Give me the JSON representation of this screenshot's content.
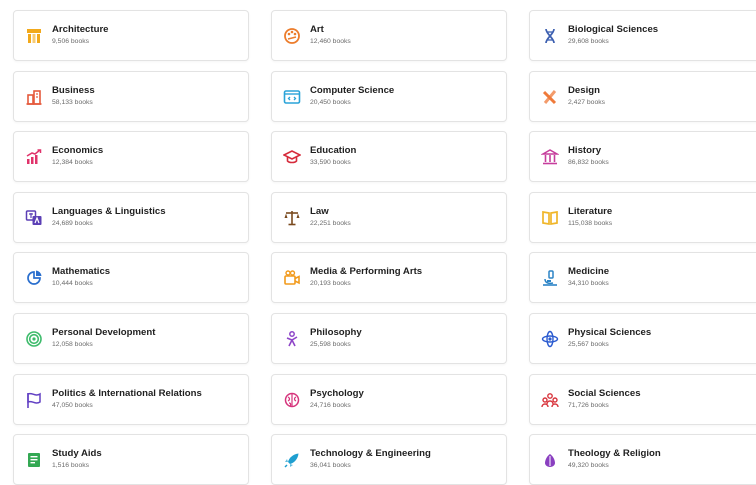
{
  "categories": [
    {
      "title": "Architecture",
      "count": "9,506 books",
      "icon": "architecture-icon",
      "color": "#f2a91b"
    },
    {
      "title": "Art",
      "count": "12,460 books",
      "icon": "palette-icon",
      "color": "#ec7c2b"
    },
    {
      "title": "Biological Sciences",
      "count": "29,608 books",
      "icon": "dna-icon",
      "color": "#3c5fb0"
    },
    {
      "title": "Business",
      "count": "58,133 books",
      "icon": "buildings-icon",
      "color": "#e55a3c"
    },
    {
      "title": "Computer Science",
      "count": "20,450 books",
      "icon": "code-window-icon",
      "color": "#2aa3d8"
    },
    {
      "title": "Design",
      "count": "2,427 books",
      "icon": "design-tools-icon",
      "color": "#ef7a3a"
    },
    {
      "title": "Economics",
      "count": "12,384 books",
      "icon": "growth-chart-icon",
      "color": "#e0336b"
    },
    {
      "title": "Education",
      "count": "33,590 books",
      "icon": "graduation-cap-icon",
      "color": "#d62b3b"
    },
    {
      "title": "History",
      "count": "86,832 books",
      "icon": "museum-icon",
      "color": "#c63d9c"
    },
    {
      "title": "Languages & Linguistics",
      "count": "24,689 books",
      "icon": "translate-icon",
      "color": "#5b3fb5"
    },
    {
      "title": "Law",
      "count": "22,251 books",
      "icon": "scales-icon",
      "color": "#7a4a1e"
    },
    {
      "title": "Literature",
      "count": "115,038 books",
      "icon": "open-book-icon",
      "color": "#f0b62a"
    },
    {
      "title": "Mathematics",
      "count": "10,444 books",
      "icon": "pie-chart-icon",
      "color": "#2b6fce"
    },
    {
      "title": "Media & Performing Arts",
      "count": "20,193 books",
      "icon": "film-camera-icon",
      "color": "#f29a1c"
    },
    {
      "title": "Medicine",
      "count": "34,310 books",
      "icon": "microscope-icon",
      "color": "#2b84c6"
    },
    {
      "title": "Personal Development",
      "count": "12,058 books",
      "icon": "target-icon",
      "color": "#3dbb6b"
    },
    {
      "title": "Philosophy",
      "count": "25,598 books",
      "icon": "thinker-icon",
      "color": "#8e46c8"
    },
    {
      "title": "Physical Sciences",
      "count": "25,567 books",
      "icon": "atom-icon",
      "color": "#2b5bd0"
    },
    {
      "title": "Politics & International Relations",
      "count": "47,050 books",
      "icon": "flag-icon",
      "color": "#6241c4"
    },
    {
      "title": "Psychology",
      "count": "24,716 books",
      "icon": "brain-icon",
      "color": "#d6347c"
    },
    {
      "title": "Social Sciences",
      "count": "71,726 books",
      "icon": "people-group-icon",
      "color": "#d8343c"
    },
    {
      "title": "Study Aids",
      "count": "1,516 books",
      "icon": "notebook-icon",
      "color": "#33a853"
    },
    {
      "title": "Technology & Engineering",
      "count": "36,041 books",
      "icon": "rocket-icon",
      "color": "#1f9fd0"
    },
    {
      "title": "Theology & Religion",
      "count": "49,320 books",
      "icon": "praying-hands-icon",
      "color": "#8a3fc0"
    }
  ]
}
